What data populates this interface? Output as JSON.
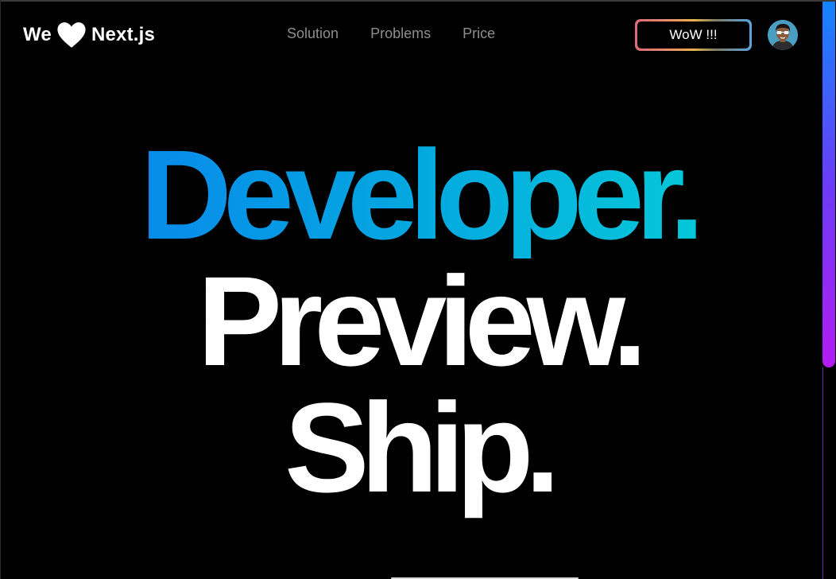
{
  "header": {
    "logo": {
      "before": "We",
      "icon": "heart-icon",
      "after": "Next.js"
    },
    "nav": [
      {
        "label": "Solution"
      },
      {
        "label": "Problems"
      },
      {
        "label": "Price"
      }
    ],
    "cta_label": "WoW !!!",
    "avatar_icon": "avatar-icon"
  },
  "hero": {
    "line1": "Developer.",
    "line2": "Preview.",
    "line3": "Ship."
  },
  "colors": {
    "background": "#000000",
    "nav_text": "#8d8d8d",
    "gradient_start": "#0a7cf0",
    "gradient_end": "#06d7d5",
    "scroll_top": "#1384ff",
    "scroll_bottom": "#b31cf2"
  }
}
